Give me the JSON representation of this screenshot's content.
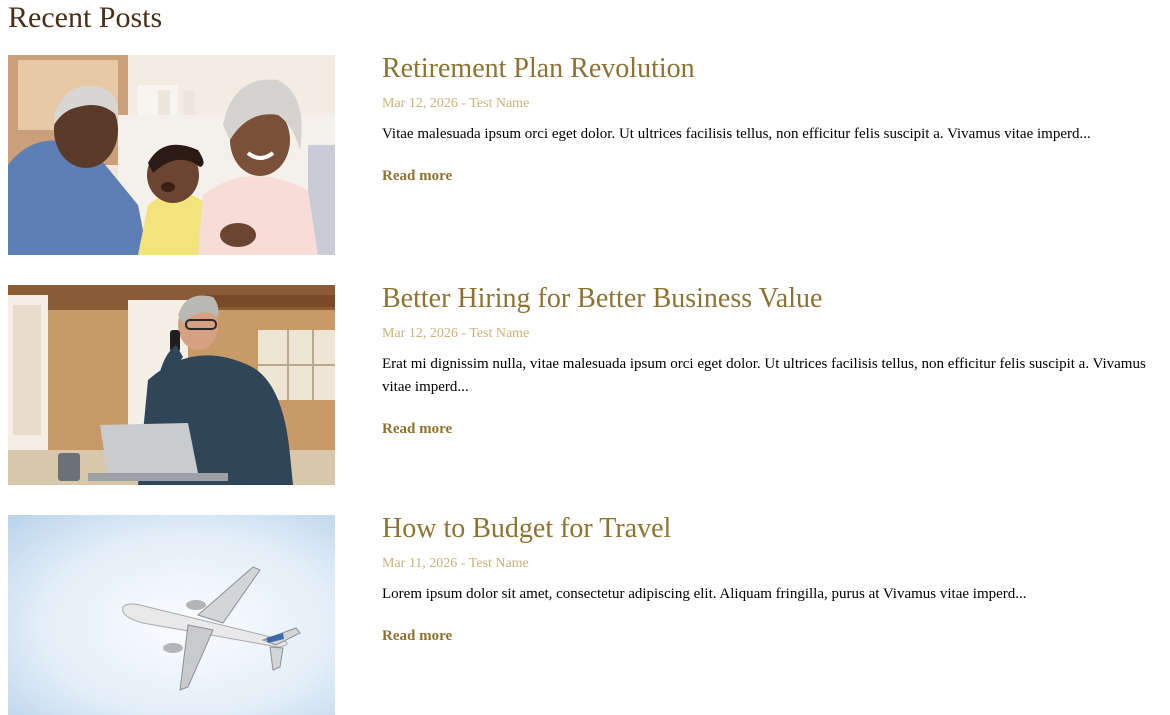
{
  "section": {
    "title": "Recent Posts"
  },
  "posts": [
    {
      "title": "Retirement Plan Revolution",
      "meta": "Mar 12, 2026 - Test Name",
      "excerpt": "Vitae malesuada ipsum orci eget dolor. Ut ultrices facilisis tellus, non efficitur felis suscipit a. Vivamus vitae imperd...",
      "read_more": "Read more",
      "image": "grandparents-with-toddler-photo"
    },
    {
      "title": "Better Hiring for Better Business Value",
      "meta": "Mar 12, 2026 - Test Name",
      "excerpt": "Erat mi dignissim nulla, vitae malesuada ipsum orci eget dolor. Ut ultrices facilisis tellus, non efficitur felis suscipit a. Vivamus vitae imperd...",
      "read_more": "Read more",
      "image": "man-on-phone-in-workshop-photo"
    },
    {
      "title": "How to Budget for Travel",
      "meta": "Mar 11, 2026 - Test Name",
      "excerpt": "Lorem ipsum dolor sit amet, consectetur adipiscing elit. Aliquam fringilla, purus at Vivamus vitae imperd...",
      "read_more": "Read more",
      "image": "airplane-in-sky-photo"
    }
  ],
  "colors": {
    "heading": "#4a2f17",
    "accent": "#8c7332",
    "meta": "#c8b27c",
    "body_text": "#000000"
  }
}
